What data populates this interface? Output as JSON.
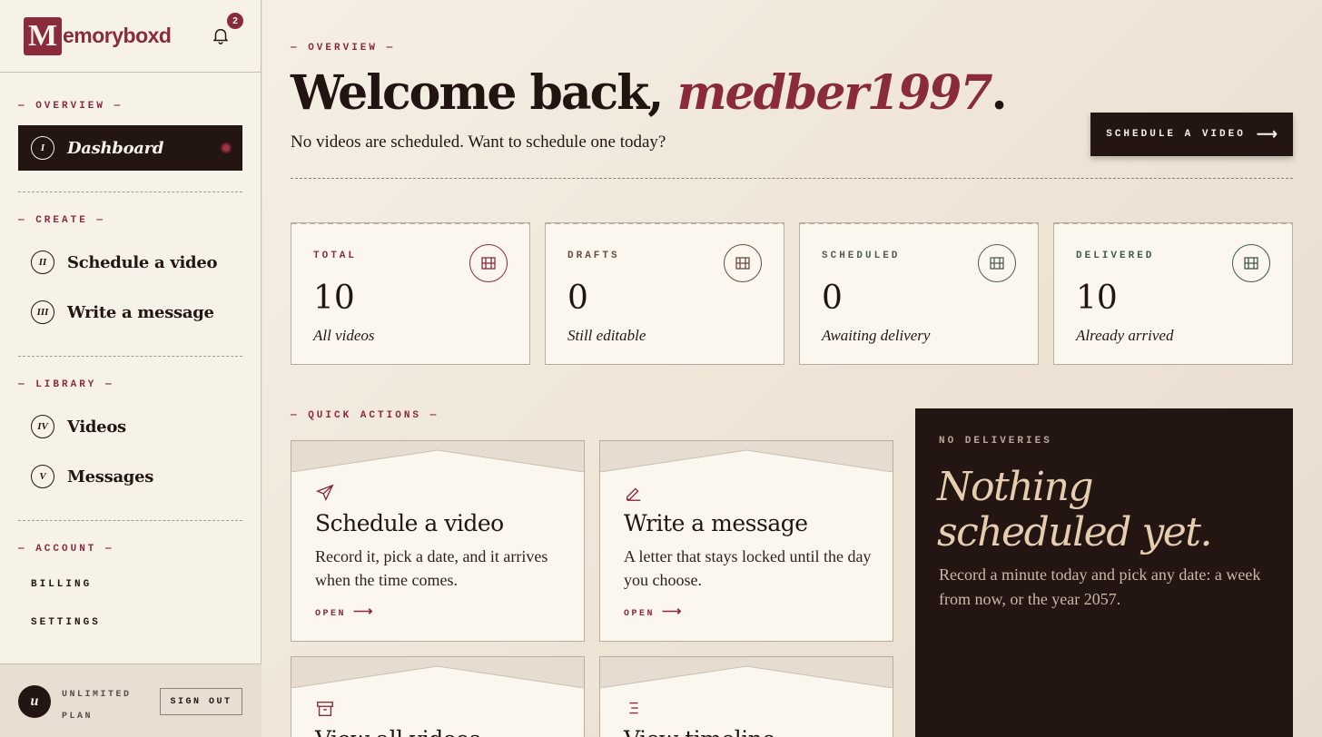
{
  "brand": {
    "logo_letter": "M",
    "logo_text": "emoryboxd",
    "notification_count": "2"
  },
  "sidebar": {
    "sections": {
      "overview": "— OVERVIEW —",
      "create": "— CREATE —",
      "library": "— LIBRARY —",
      "account": "— ACCOUNT —"
    },
    "items": [
      {
        "numeral": "I",
        "label": "Dashboard",
        "active": true
      },
      {
        "numeral": "II",
        "label": "Schedule a video"
      },
      {
        "numeral": "III",
        "label": "Write a message"
      },
      {
        "numeral": "IV",
        "label": "Videos"
      },
      {
        "numeral": "V",
        "label": "Messages"
      }
    ],
    "account_links": {
      "billing": "BILLING",
      "settings": "SETTINGS"
    },
    "footer": {
      "avatar_initial": "u",
      "plan_line1": "UNLIMITED",
      "plan_line2": "PLAN",
      "sign_out": "SIGN OUT"
    }
  },
  "header": {
    "kicker": "— OVERVIEW —",
    "welcome_prefix": "Welcome back, ",
    "username": "medber1997",
    "welcome_suffix": ".",
    "subtitle": "No videos are scheduled. Want to schedule one today?",
    "cta_label": "SCHEDULE A VIDEO",
    "cta_arrow": "⟶"
  },
  "stats": [
    {
      "label": "TOTAL",
      "value": "10",
      "caption": "All videos",
      "color": "#8a2b3c"
    },
    {
      "label": "DRAFTS",
      "value": "0",
      "caption": "Still editable",
      "color": "#6b4a3d"
    },
    {
      "label": "SCHEDULED",
      "value": "0",
      "caption": "Awaiting delivery",
      "color": "#4f5e52"
    },
    {
      "label": "DELIVERED",
      "value": "10",
      "caption": "Already arrived",
      "color": "#3f5a4a"
    }
  ],
  "quick_actions": {
    "kicker": "— QUICK ACTIONS —",
    "cards": [
      {
        "title": "Schedule a video",
        "description": "Record it, pick a date, and it arrives when the time comes.",
        "open_label": "OPEN",
        "icon": "send-icon"
      },
      {
        "title": "Write a message",
        "description": "A letter that stays locked until the day you choose.",
        "open_label": "OPEN",
        "icon": "pen-icon"
      },
      {
        "title": "View all videos",
        "icon": "archive-icon"
      },
      {
        "title": "View timeline",
        "icon": "list-icon"
      }
    ],
    "arrow": "⟶"
  },
  "deliveries": {
    "kicker": "NO DELIVERIES",
    "title": "Nothing scheduled yet.",
    "description": "Record a minute today and pick any date: a week from now, or the year 2057."
  }
}
